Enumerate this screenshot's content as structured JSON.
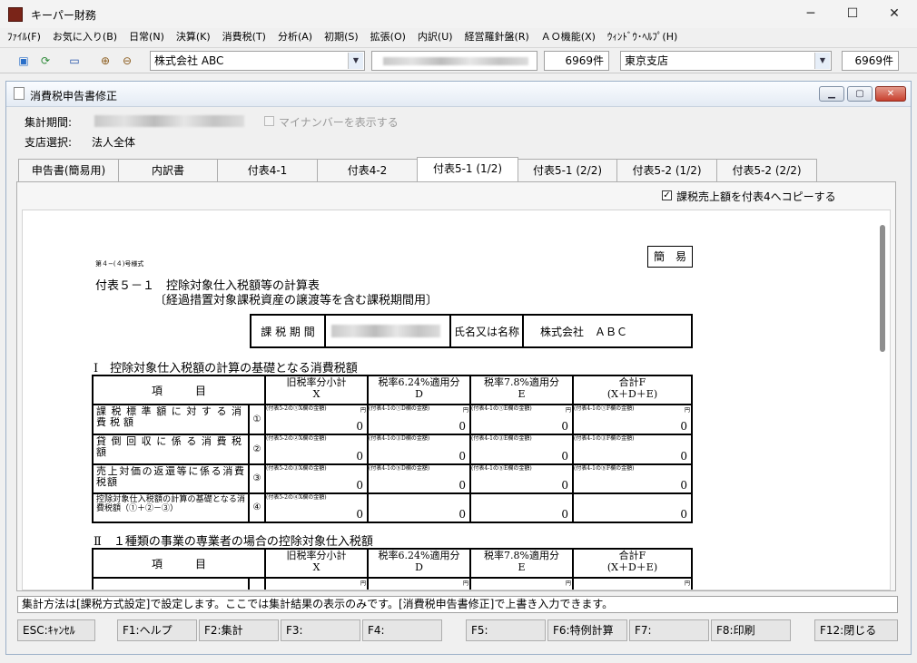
{
  "app": {
    "title": "キーパー財務"
  },
  "menu": [
    "ﾌｧｲﾙ(F)",
    "お気に入り(B)",
    "日常(N)",
    "決算(K)",
    "消費税(T)",
    "分析(A)",
    "初期(S)",
    "拡張(O)",
    "内訳(U)",
    "経営羅針盤(R)",
    "ＡＯ機能(X)",
    "ｳｨﾝﾄﾞｳ･ﾍﾙﾌﾟ(H)"
  ],
  "toolbar": {
    "company": "株式会社 ABC",
    "count1": "6969件",
    "branch": "東京支店",
    "count2": "6969件"
  },
  "window": {
    "title": "消費税申告書修正"
  },
  "header": {
    "period_label": "集計期間:",
    "mynumber_label": "マイナンバーを表示する",
    "branch_label": "支店選択:",
    "branch_value": "法人全体"
  },
  "tabs": [
    "申告書(簡易用)",
    "内訳書",
    "付表4-1",
    "付表4-2",
    "付表5-1 (1/2)",
    "付表5-1 (2/2)",
    "付表5-2 (1/2)",
    "付表5-2 (2/2)"
  ],
  "copy_checkbox": "課税売上額を付表4へコピーする",
  "form": {
    "form_no": "第４−(４)号様式",
    "simple": "簡　易",
    "title1": "付表５－１　控除対象仕入税額等の計算表",
    "title2": "〔経過措置対象課税資産の譲渡等を含む課税期間用〕",
    "period_label": "課 税 期 間",
    "name_label": "氏名又は名称",
    "name_value": "株式会社　ＡＢＣ",
    "sec1": "Ⅰ　控除対象仕入税額の計算の基礎となる消費税額",
    "sec2": "Ⅱ　１種類の事業の専業者の場合の控除対象仕入税額",
    "col_item": "項　　　目",
    "colX": "旧税率分小計",
    "colXl": "X",
    "colD": "税率6.24%適用分",
    "colDl": "D",
    "colE": "税率7.8%適用分",
    "colEl": "E",
    "colF": "合計F",
    "colFl": "(X＋D＋E)",
    "yen": "円",
    "rows": [
      {
        "label": "課税標準額に対する消費税額",
        "no": "①",
        "x": "(付表5-2の①X欄の金額)",
        "d": "(付表4-1の①D欄の金額)",
        "e": "(付表4-1の①E欄の金額)",
        "f": "(付表4-1の①F欄の金額)",
        "vx": "0",
        "vd": "0",
        "ve": "0",
        "vf": "0"
      },
      {
        "label": "貸倒回収に係る消費税額",
        "no": "②",
        "x": "(付表5-2の②X欄の金額)",
        "d": "(付表4-1の③D欄の金額)",
        "e": "(付表4-1の③E欄の金額)",
        "f": "(付表4-1の③F欄の金額)",
        "vx": "0",
        "vd": "0",
        "ve": "0",
        "vf": "0"
      },
      {
        "label": "売上対価の返還等に係る消費税額",
        "no": "③",
        "x": "(付表5-2の③X欄の金額)",
        "d": "(付表4-1の⑤D欄の金額)",
        "e": "(付表4-1の⑤E欄の金額)",
        "f": "(付表4-1の⑤F欄の金額)",
        "vx": "0",
        "vd": "0",
        "ve": "0",
        "vf": "0"
      },
      {
        "label": "控除対象仕入税額の計算の基礎となる消費税額（①＋②－③）",
        "no": "④",
        "x": "(付表5-2の④X欄の金額)",
        "d": "",
        "e": "",
        "f": "",
        "vx": "0",
        "vd": "0",
        "ve": "0",
        "vf": "0"
      }
    ]
  },
  "status": "集計方法は[課税方式設定]で設定します。ここでは集計結果の表示のみです。[消費税申告書修正]で上書き入力できます。",
  "fkeys": [
    "ESC:ｷｬﾝｾﾙ",
    "F1:ヘルプ",
    "F2:集計",
    "F3:",
    "F4:",
    "F5:",
    "F6:特例計算",
    "F7:",
    "F8:印刷",
    "F12:閉じる"
  ]
}
